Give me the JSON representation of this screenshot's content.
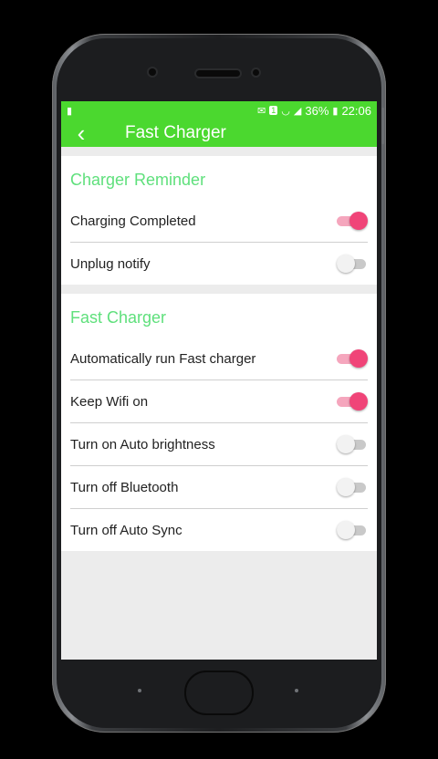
{
  "status": {
    "sim_indicator": "1",
    "battery_percent": "36%",
    "time": "22:06"
  },
  "appbar": {
    "title": "Fast Charger"
  },
  "sections": [
    {
      "title": "Charger Reminder",
      "items": [
        {
          "label": "Charging Completed",
          "on": true
        },
        {
          "label": "Unplug notify",
          "on": false
        }
      ]
    },
    {
      "title": "Fast Charger",
      "items": [
        {
          "label": "Automatically run Fast charger",
          "on": true
        },
        {
          "label": "Keep Wifi on",
          "on": true
        },
        {
          "label": "Turn on Auto brightness",
          "on": false
        },
        {
          "label": "Turn off Bluetooth",
          "on": false
        },
        {
          "label": "Turn off Auto Sync",
          "on": false
        }
      ]
    }
  ],
  "colors": {
    "accent": "#4bd82f",
    "section_title": "#5fe07c",
    "switch_on": "#f04478"
  }
}
